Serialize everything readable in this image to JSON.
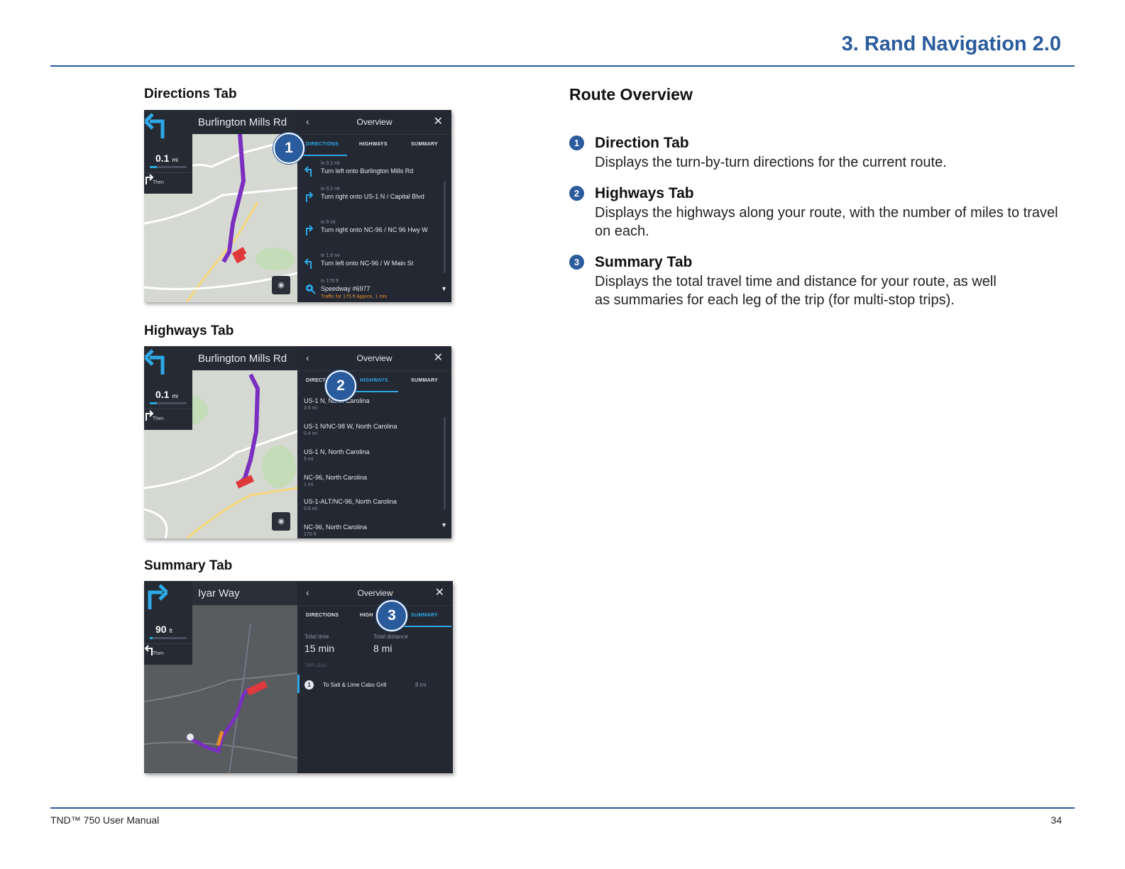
{
  "header": {
    "chapter_title": "3. Rand Navigation 2.0"
  },
  "footer": {
    "manual_name": "TND™ 750 User Manual",
    "page_number": "34"
  },
  "figures": {
    "directions": {
      "label": "Directions Tab",
      "street": "Burlington Mills Rd",
      "distance_value": "0.1",
      "distance_unit": "mi",
      "then_label": "Then",
      "panel_title": "Overview",
      "tabs": [
        "DIRECTIONS",
        "HIGHWAYS",
        "SUMMARY"
      ],
      "active_tab": "DIRECTIONS",
      "callout": "1",
      "steps": [
        {
          "distance": "in 0.1 mi",
          "text": "Turn left onto Burlington Mills Rd",
          "icon": "turn-left-icon"
        },
        {
          "distance": "in 0.2 mi",
          "text": "Turn right onto US-1 N / Capital Blvd",
          "icon": "turn-right-icon"
        },
        {
          "distance": "in 9 mi",
          "text": "Turn right onto NC-96 / NC 96 Hwy W",
          "icon": "turn-right-icon"
        },
        {
          "distance": "in 1.6 mi",
          "text": "Turn left onto NC-96 / W Main St",
          "icon": "turn-left-icon"
        },
        {
          "distance": "in 175 ft",
          "text": "Speedway #6977",
          "icon": "destination-icon",
          "traffic": "Traffic for 175 ft  Approx. 1 min"
        }
      ]
    },
    "highways": {
      "label": "Highways Tab",
      "street": "Burlington Mills Rd",
      "distance_value": "0.1",
      "distance_unit": "mi",
      "then_label": "Then",
      "panel_title": "Overview",
      "tabs": [
        "DIRECTIONS",
        "HIGHWAYS",
        "SUMMARY"
      ],
      "tab_visible_labels": [
        "DIRECT",
        "HIGHWAYS",
        "SUMMARY"
      ],
      "active_tab": "HIGHWAYS",
      "callout": "2",
      "rows": [
        {
          "name": "US-1 N, North Carolina",
          "miles": "3.6 mi"
        },
        {
          "name": "US-1 N/NC-98 W, North Carolina",
          "miles": "0.4 mi"
        },
        {
          "name": "US-1 N, North Carolina",
          "miles": "5 mi"
        },
        {
          "name": "NC-96, North Carolina",
          "miles": "1 mi"
        },
        {
          "name": "US-1-ALT/NC-96, North Carolina",
          "miles": "0.6 mi"
        },
        {
          "name": "NC-96, North Carolina",
          "miles": "175 ft"
        }
      ]
    },
    "summary": {
      "label": "Summary Tab",
      "street": "Iyar Way",
      "distance_value": "90",
      "distance_unit": "ft",
      "then_label": "Then",
      "panel_title": "Overview",
      "tabs": [
        "DIRECTIONS",
        "HIGHWAYS",
        "SUMMARY"
      ],
      "tab_visible_labels": [
        "DIRECTIONS",
        "HIGH",
        "SUMMARY"
      ],
      "active_tab": "SUMMARY",
      "callout": "3",
      "total_time_label": "Total time",
      "total_time": "15 min",
      "total_distance_label": "Total distance",
      "total_distance": "8 mi",
      "trip_legs_label": "TRIP LEGS",
      "legs": [
        {
          "number": "1",
          "name": "To Salt & Lime Cabo Grill",
          "miles": "8 mi"
        }
      ]
    }
  },
  "route_overview": {
    "title": "Route Overview",
    "items": [
      {
        "number": "1",
        "title": "Direction Tab",
        "body": "Displays the turn-by-turn directions for the current route."
      },
      {
        "number": "2",
        "title": "Highways Tab",
        "body": "Displays the highways along your route, with the number of miles to travel on each."
      },
      {
        "number": "3",
        "title": "Summary Tab",
        "body": "Displays the total travel time and distance for your route, as well as summaries for each leg of the trip (for multi-stop trips)."
      }
    ]
  },
  "colors": {
    "accent": "#2a5b9c",
    "active_tab": "#2ea8e6",
    "route": "#7a2fc0",
    "vehicle": "#e0393b"
  }
}
